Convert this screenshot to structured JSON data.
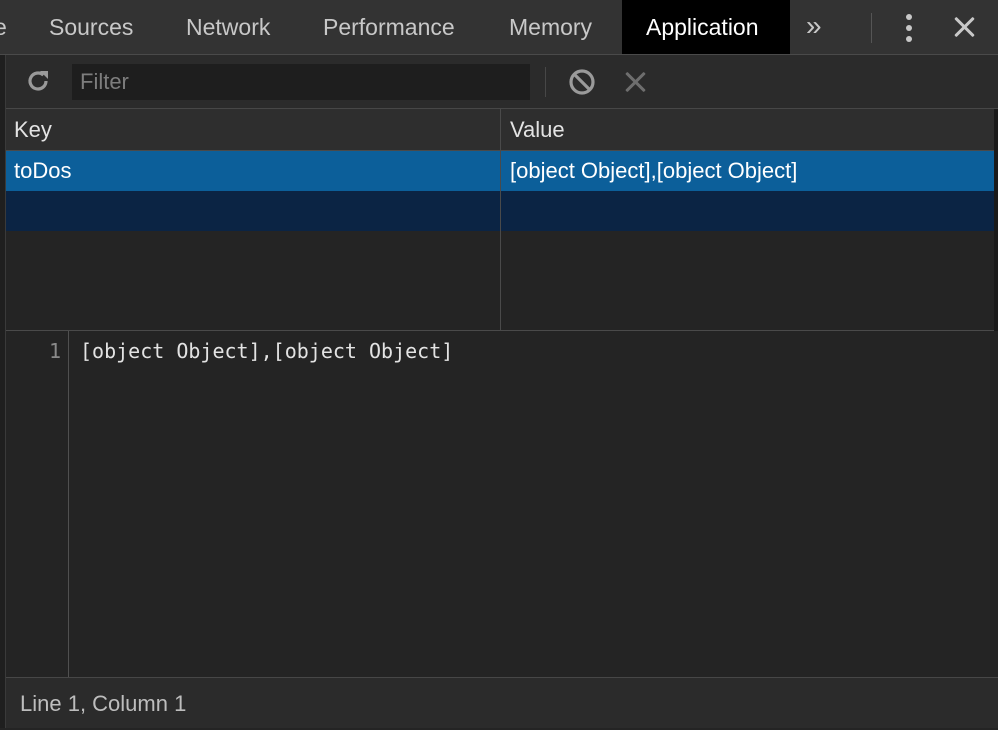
{
  "tabs": [
    {
      "label": "e",
      "active": false
    },
    {
      "label": "Sources",
      "active": false
    },
    {
      "label": "Network",
      "active": false
    },
    {
      "label": "Performance",
      "active": false
    },
    {
      "label": "Memory",
      "active": false
    },
    {
      "label": "Application",
      "active": true
    }
  ],
  "tabbar": {
    "more_label": "»",
    "more_icon": "chevron-double-right-icon",
    "menu_icon": "vertical-dots-icon",
    "close_icon": "close-icon"
  },
  "toolbar": {
    "refresh_icon": "refresh-icon",
    "filter_placeholder": "Filter",
    "filter_value": "",
    "block_icon": "block-icon",
    "clear_icon": "clear-icon"
  },
  "grid": {
    "columns": [
      "Key",
      "Value"
    ],
    "rows": [
      {
        "key": "toDos",
        "value": "[object Object],[object Object]",
        "selected": true
      }
    ]
  },
  "editor": {
    "lines": [
      {
        "number": "1",
        "text": "[object Object],[object Object]"
      }
    ]
  },
  "status": {
    "text": "Line 1, Column 1"
  },
  "colors": {
    "active_tab_bg": "#000000",
    "selected_row_bg": "#0c5f9a",
    "empty_row_bg": "#0b2444",
    "panel_bg": "#242424"
  }
}
